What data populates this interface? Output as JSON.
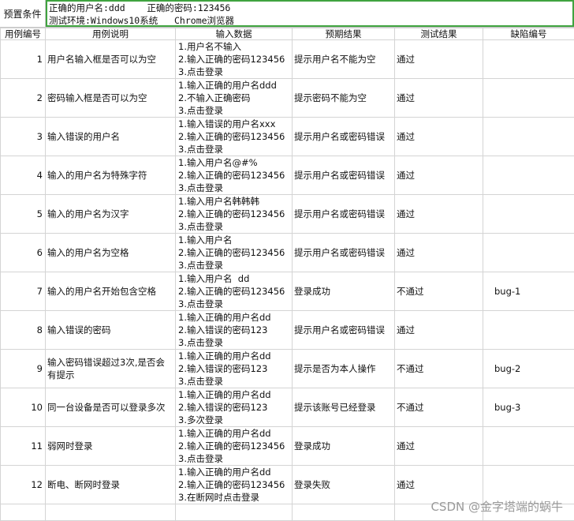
{
  "precondition": {
    "label": "预置条件",
    "line1": "正确的用户名:ddd    正确的密码:123456",
    "line2": "测试环境:Windows10系统   Chrome浏览器"
  },
  "headers": [
    "用例编号",
    "用例说明",
    "输入数据",
    "预期结果",
    "测试结果",
    "缺陷编号"
  ],
  "rows": [
    {
      "id": "1",
      "desc": "用户名输入框是否可以为空",
      "input": [
        "1.用户名不输入",
        "2.输入正确的密码123456",
        "3.点击登录"
      ],
      "expected": "提示用户名不能为空",
      "result": "通过",
      "bug": ""
    },
    {
      "id": "2",
      "desc": "密码输入框是否可以为空",
      "input": [
        "1.输入正确的用户名ddd",
        "2.不输入正确密码",
        "3.点击登录"
      ],
      "expected": "提示密码不能为空",
      "result": "通过",
      "bug": ""
    },
    {
      "id": "3",
      "desc": "输入错误的用户名",
      "input": [
        "1.输入错误的用户名xxx",
        "2.输入正确的密码123456",
        "3.点击登录"
      ],
      "expected": "提示用户名或密码错误",
      "result": "通过",
      "bug": ""
    },
    {
      "id": "4",
      "desc": "输入的用户名为特殊字符",
      "input": [
        "1.输入用户名@#%",
        "2.输入正确的密码123456",
        "3.点击登录"
      ],
      "expected": "提示用户名或密码错误",
      "result": "通过",
      "bug": ""
    },
    {
      "id": "5",
      "desc": "输入的用户名为汉字",
      "input": [
        "1.输入用户名韩韩韩",
        "2.输入正确的密码123456",
        "3.点击登录"
      ],
      "expected": "提示用户名或密码错误",
      "result": "通过",
      "bug": ""
    },
    {
      "id": "6",
      "desc": "输入的用户名为空格",
      "input": [
        "1.输入用户名",
        "2.输入正确的密码123456",
        "3.点击登录"
      ],
      "expected": "提示用户名或密码错误",
      "result": "通过",
      "bug": ""
    },
    {
      "id": "7",
      "desc": "输入的用户名开始包含空格",
      "input": [
        "1.输入用户名  dd",
        "2.输入正确的密码123456",
        "3.点击登录"
      ],
      "expected": "登录成功",
      "result": "不通过",
      "bug": "bug-1"
    },
    {
      "id": "8",
      "desc": "输入错误的密码",
      "input": [
        "1.输入正确的用户名dd",
        "2.输入错误的密码123",
        "3.点击登录"
      ],
      "expected": "提示用户名或密码错误",
      "result": "通过",
      "bug": ""
    },
    {
      "id": "9",
      "desc": "输入密码错误超过3次,是否会有提示",
      "input": [
        "1.输入正确的用户名dd",
        "2.输入错误的密码123",
        "3.点击登录"
      ],
      "expected": "提示是否为本人操作",
      "result": "不通过",
      "bug": "bug-2"
    },
    {
      "id": "10",
      "desc": "同一台设备是否可以登录多次",
      "input": [
        "1.输入正确的用户名dd",
        "2.输入错误的密码123",
        "3.多次登录"
      ],
      "expected": "提示该账号已经登录",
      "result": "不通过",
      "bug": "bug-3"
    },
    {
      "id": "11",
      "desc": "弱网时登录",
      "input": [
        "1.输入正确的用户名dd",
        "2.输入正确的密码123456",
        "3.点击登录"
      ],
      "expected": "登录成功",
      "result": "通过",
      "bug": ""
    },
    {
      "id": "12",
      "desc": "断电、断网时登录",
      "input": [
        "1.输入正确的用户名dd",
        "2.输入正确的密码123456",
        "3.在断网时点击登录"
      ],
      "expected": "登录失败",
      "result": "通过",
      "bug": ""
    }
  ],
  "watermark": "CSDN @金字塔端的蜗牛"
}
